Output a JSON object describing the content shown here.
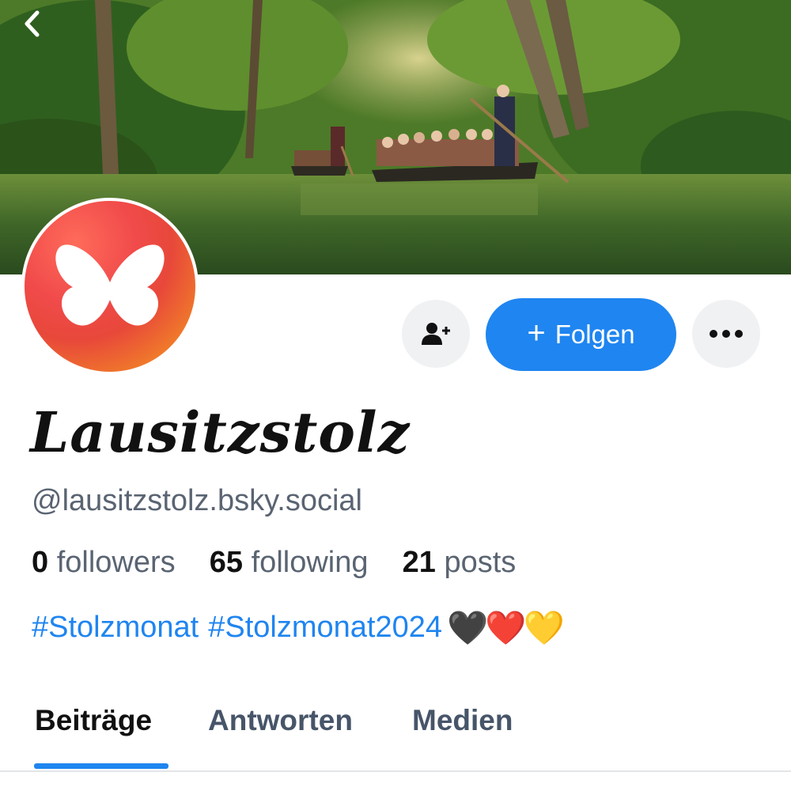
{
  "profile": {
    "display_name": "Lausitzstolz",
    "handle": "@lausitzstolz.bsky.social",
    "stats": {
      "followers_count": "0",
      "followers_label": "followers",
      "following_count": "65",
      "following_label": "following",
      "posts_count": "21",
      "posts_label": "posts"
    },
    "bio": {
      "tag1": "#Stolzmonat",
      "tag2": "#Stolzmonat2024",
      "hearts": [
        "🖤",
        "❤️",
        "💛"
      ]
    }
  },
  "actions": {
    "follow_plus": "+",
    "follow_label": "Folgen"
  },
  "tabs": [
    {
      "label": "Beiträge",
      "active": true
    },
    {
      "label": "Antworten",
      "active": false
    },
    {
      "label": "Medien",
      "active": false
    }
  ],
  "icons": {
    "back": "chevron-left-icon",
    "add_user": "person-plus-icon",
    "more": "ellipsis-icon",
    "avatar": "butterfly-icon"
  },
  "colors": {
    "accent": "#1f85f0",
    "button_gray": "#f0f1f3",
    "text_muted": "#5a6472"
  }
}
